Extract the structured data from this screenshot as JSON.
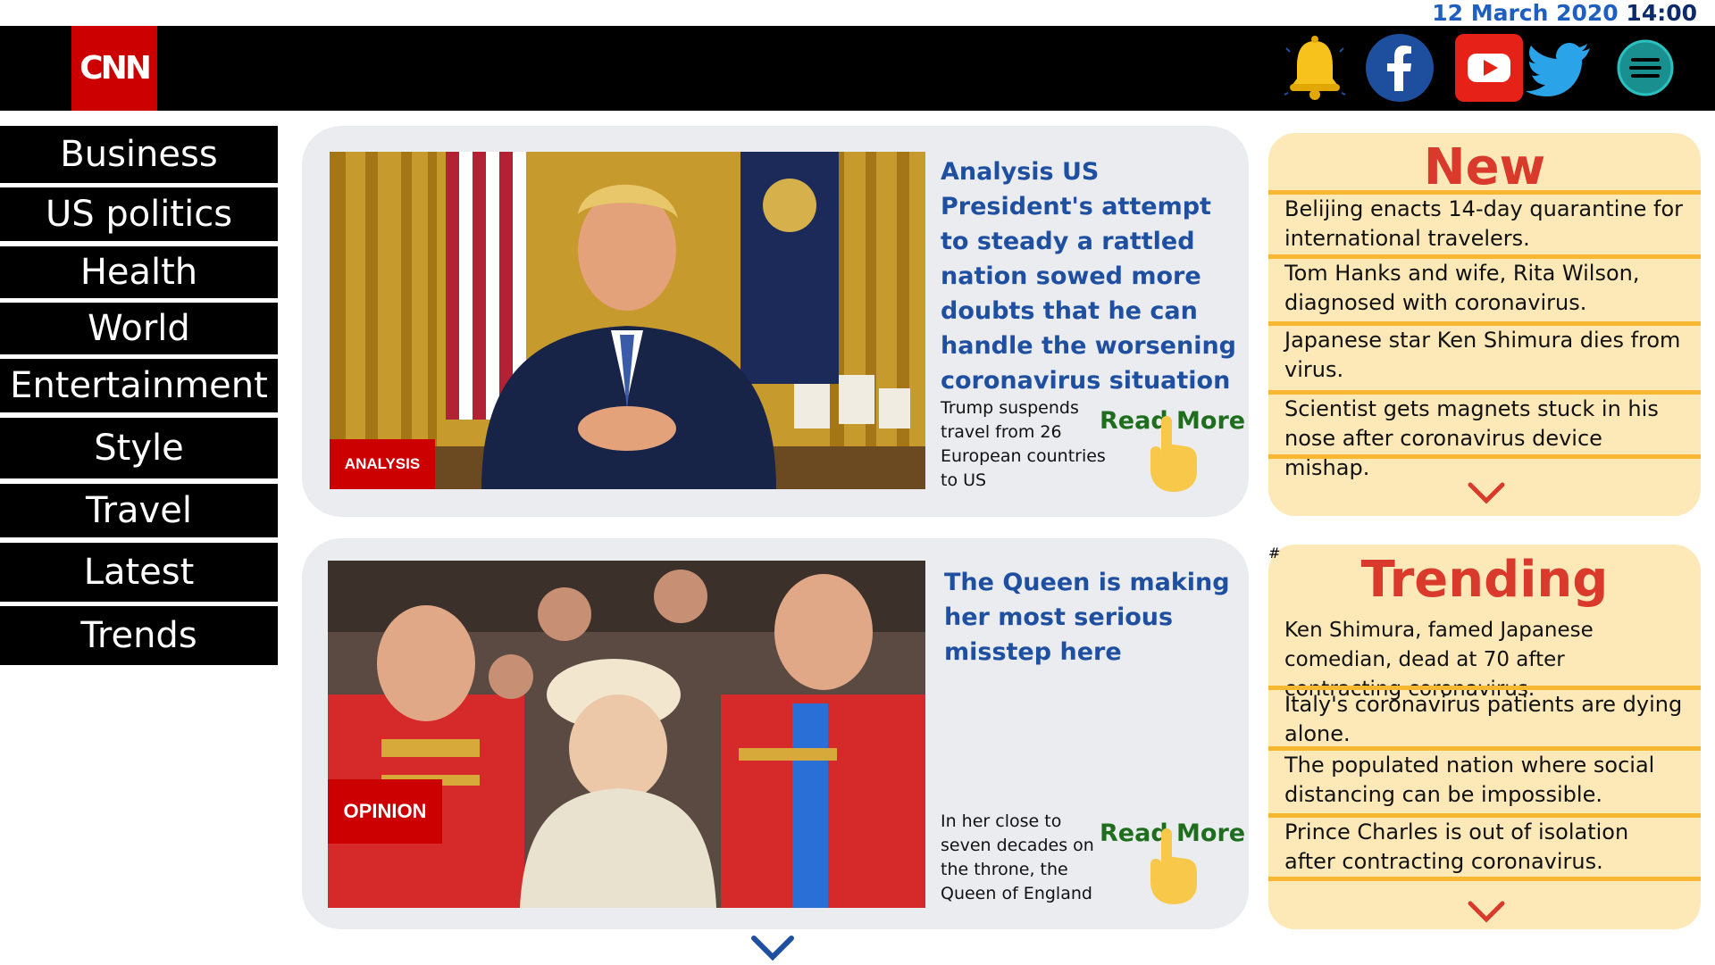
{
  "datetime": {
    "date": "12 March 2020",
    "time": "14:00"
  },
  "header": {
    "logo": "CNN",
    "icons": [
      "bell-icon",
      "facebook-icon",
      "youtube-icon",
      "twitter-icon",
      "menu-icon"
    ]
  },
  "sidebar": {
    "items": [
      {
        "label": "Business"
      },
      {
        "label": "US politics"
      },
      {
        "label": "Health"
      },
      {
        "label": "World"
      },
      {
        "label": "Entertainment"
      },
      {
        "label": "Style"
      },
      {
        "label": "Travel"
      },
      {
        "label": "Latest"
      },
      {
        "label": "Trends"
      }
    ]
  },
  "articles": [
    {
      "tag": "ANALYSIS",
      "headline": "Analysis US President's attempt to steady a rattled nation sowed more doubts that he can handle the worsening coronavirus situation",
      "summary": "Trump suspends travel from 26 European countries to US",
      "read_more": "Read More"
    },
    {
      "tag": "OPINION",
      "headline": "The Queen is making her most serious misstep here",
      "summary": "In her close to seven decades on the throne, the Queen of England",
      "read_more": "Read More"
    }
  ],
  "new_panel": {
    "title": "New",
    "items": [
      "Belijing enacts 14-day quarantine for international travelers.",
      "Tom Hanks and wife, Rita Wilson, diagnosed with coronavirus.",
      "Japanese star Ken Shimura dies from virus.",
      "Scientist gets magnets stuck in his nose after coronavirus device mishap."
    ]
  },
  "trending_panel": {
    "title": "Trending",
    "items": [
      "Ken Shimura, famed Japanese comedian, dead at 70 after contracting coronavirus.",
      "Italy's coronavirus patients are dying alone.",
      "The populated nation where social distancing can be impossible.",
      "Prince Charles is out of isolation after contracting coronavirus."
    ]
  },
  "colors": {
    "brand_red": "#cc0000",
    "headline_blue": "#1f4fa0",
    "panel_bg": "#fde9b8",
    "panel_border": "#f5b830",
    "panel_title": "#d93a2b",
    "read_more_green": "#1e6e1e"
  }
}
